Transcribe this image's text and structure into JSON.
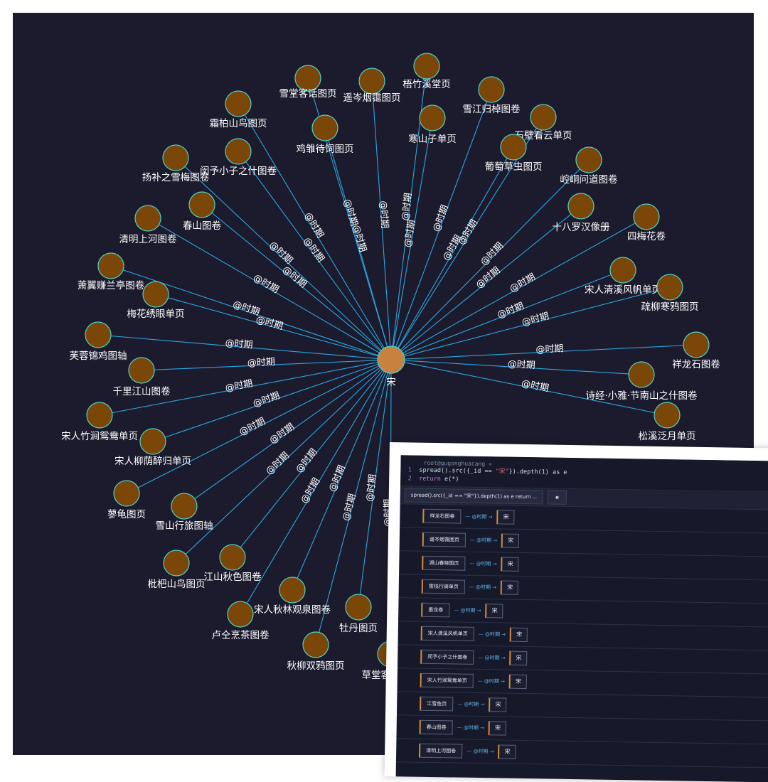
{
  "graph": {
    "center": "宋",
    "edge_label": "@时期",
    "nodes": [
      "雪堂客话图页",
      "遥岑烟霭图页",
      "梧竹溪堂页",
      "雪江归棹图卷",
      "石壁看云单页",
      "霜柏山鸟图页",
      "鸡雏待饲图页",
      "寒山子单页",
      "葡萄草虫图页",
      "崆峒问道图卷",
      "扬补之雪梅图卷",
      "闵予小子之什图卷",
      "春山图卷",
      "十八罗汉像册",
      "四梅花卷",
      "清明上河图卷",
      "萧翼赚兰亭图卷",
      "梅花绣眼单页",
      "宋人清溪风帆单页",
      "疏柳寒鸦图页",
      "芙蓉锦鸡图轴",
      "千里江山图卷",
      "祥龙石图卷",
      "诗经·小雅·节南山之什图卷",
      "宋人竹涧鸳鸯单页",
      "宋人柳荫醉归单页",
      "松溪泛月单页",
      "蓼龟图页",
      "雪山行旅图轴",
      "枇杷山鸟图页",
      "江山秋色图卷",
      "宋人秋林观泉图卷",
      "卢仝烹茶图卷",
      "牡丹图页",
      "秋柳双鸦图页",
      "草堂客话图页"
    ]
  },
  "query": {
    "user": "root@gugonghuacang »",
    "line1_no": "1",
    "line1_a": "spread().src({_id == ",
    "line1_str": "\"宋\"",
    "line1_b": "}).depth(1) as e",
    "line2_no": "2",
    "line2_kw": "return",
    "line2_b": " e(*)",
    "result_tab": "spread().src({_id == \"宋\"}).depth(1) as e return ...",
    "alias_tab": "e",
    "arrow_text": "— @时期 →",
    "target": "宋",
    "rows": [
      "祥龙石图卷",
      "遥岑烟霭图页",
      "湖山春晓图页",
      "雪栈行骑单页",
      "墨龙卷",
      "宋人清溪风帆单页",
      "闵予小子之什图卷",
      "宋人竹涧鸳鸯单页",
      "江雪鱼页",
      "春山图卷",
      "清明上河图卷"
    ]
  },
  "colors": {
    "background": "#1c1b2e",
    "edge": "#2aa6e0",
    "node": "#7a4708",
    "center": "#c8813f"
  }
}
